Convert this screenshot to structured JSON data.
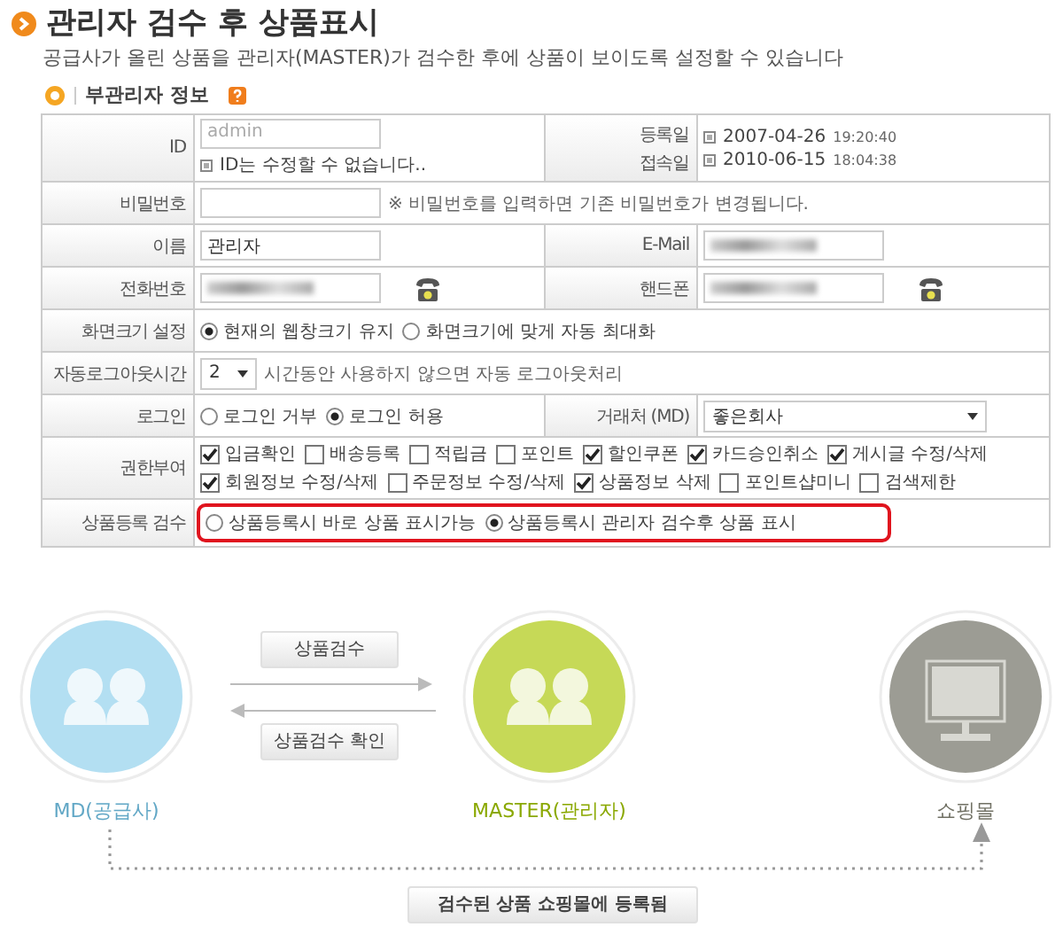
{
  "title": "관리자 검수 후 상품표시",
  "subtitle": "공급사가 올린 상품을 관리자(MASTER)가 검수한 후에 상품이 보이도록 설정할 수 있습니다",
  "section": {
    "title": "부관리자 정보"
  },
  "rows": [
    {
      "highlighted": false,
      "cells": [
        {
          "kind": "label",
          "labels": [
            "ID"
          ]
        },
        {
          "kind": "value",
          "lines": [
            [
              {
                "kind": "input",
                "value": "admin",
                "disabled": true
              }
            ],
            [
              {
                "kind": "note",
                "text": "ID는 수정할 수 없습니다.."
              }
            ]
          ]
        },
        {
          "kind": "label",
          "labels": [
            "등록일",
            "접속일"
          ]
        },
        {
          "kind": "value",
          "lines": [
            [
              {
                "kind": "date",
                "date": "2007-04-26",
                "time": "19:20:40"
              }
            ],
            [
              {
                "kind": "date",
                "date": "2010-06-15",
                "time": "18:04:38"
              }
            ]
          ]
        }
      ]
    },
    {
      "highlighted": false,
      "cells": [
        {
          "kind": "label",
          "labels": [
            "비밀번호"
          ]
        },
        {
          "kind": "value",
          "lines": [
            [
              {
                "kind": "input"
              },
              {
                "kind": "text",
                "text": "※ 비밀번호를 입력하면 기존 비밀번호가 변경됩니다."
              }
            ]
          ]
        }
      ]
    },
    {
      "highlighted": false,
      "cells": [
        {
          "kind": "label",
          "labels": [
            "이름"
          ]
        },
        {
          "kind": "value",
          "lines": [
            [
              {
                "kind": "input",
                "value": "관리자"
              }
            ]
          ]
        },
        {
          "kind": "label",
          "labels": [
            "E-Mail"
          ]
        },
        {
          "kind": "value",
          "lines": [
            [
              {
                "kind": "input",
                "blurred": true
              }
            ]
          ]
        }
      ]
    },
    {
      "highlighted": false,
      "cells": [
        {
          "kind": "label",
          "labels": [
            "전화번호"
          ]
        },
        {
          "kind": "value",
          "lines": [
            [
              {
                "kind": "input",
                "blurred": true
              },
              {
                "kind": "phone"
              }
            ]
          ]
        },
        {
          "kind": "label",
          "labels": [
            "핸드폰"
          ]
        },
        {
          "kind": "value",
          "lines": [
            [
              {
                "kind": "input",
                "blurred": true
              },
              {
                "kind": "phone"
              }
            ]
          ]
        }
      ]
    },
    {
      "highlighted": false,
      "cells": [
        {
          "kind": "label",
          "labels": [
            "화면크기 설정"
          ]
        },
        {
          "kind": "value",
          "lines": [
            [
              {
                "kind": "radio",
                "label": "현재의 웹창크기 유지",
                "selected": true
              },
              {
                "kind": "radio",
                "label": "화면크기에 맞게 자동 최대화",
                "selected": false
              }
            ]
          ]
        }
      ]
    },
    {
      "highlighted": false,
      "cells": [
        {
          "kind": "label",
          "labels": [
            "자동로그아웃시간"
          ]
        },
        {
          "kind": "value",
          "lines": [
            [
              {
                "kind": "select",
                "value": "2"
              },
              {
                "kind": "text",
                "text": "시간동안 사용하지 않으면 자동 로그아웃처리"
              }
            ]
          ]
        }
      ]
    },
    {
      "highlighted": false,
      "cells": [
        {
          "kind": "label",
          "labels": [
            "로그인"
          ]
        },
        {
          "kind": "value",
          "lines": [
            [
              {
                "kind": "radio",
                "label": "로그인 거부",
                "selected": false
              },
              {
                "kind": "radio",
                "label": "로그인 허용",
                "selected": true
              }
            ]
          ]
        },
        {
          "kind": "label",
          "labels": [
            "거래처 (MD)"
          ]
        },
        {
          "kind": "value",
          "lines": [
            [
              {
                "kind": "select",
                "value": "좋은회사"
              }
            ]
          ]
        }
      ]
    },
    {
      "highlighted": false,
      "cells": [
        {
          "kind": "label",
          "labels": [
            "권한부여"
          ]
        },
        {
          "kind": "value",
          "lines": [
            [
              {
                "kind": "checkbox",
                "label": "입금확인",
                "checked": true
              },
              {
                "kind": "checkbox",
                "label": "배송등록",
                "checked": false
              },
              {
                "kind": "checkbox",
                "label": "적립금",
                "checked": false
              },
              {
                "kind": "checkbox",
                "label": "포인트",
                "checked": false
              },
              {
                "kind": "checkbox",
                "label": "할인쿠폰",
                "checked": true
              },
              {
                "kind": "checkbox",
                "label": "카드승인취소",
                "checked": true
              },
              {
                "kind": "checkbox",
                "label": "게시글 수정/삭제",
                "checked": true
              }
            ],
            [
              {
                "kind": "checkbox",
                "label": "회원정보 수정/삭제",
                "checked": true
              },
              {
                "kind": "checkbox",
                "label": "주문정보 수정/삭제",
                "checked": false
              },
              {
                "kind": "checkbox",
                "label": "상품정보 삭제",
                "checked": true
              },
              {
                "kind": "checkbox",
                "label": "포인트샵미니",
                "checked": false
              },
              {
                "kind": "checkbox",
                "label": "검색제한",
                "checked": false
              }
            ]
          ]
        }
      ]
    },
    {
      "highlighted": true,
      "cells": [
        {
          "kind": "label",
          "labels": [
            "상품등록 검수"
          ]
        },
        {
          "kind": "value",
          "lines": [
            [
              {
                "kind": "radio",
                "label": "상품등록시 바로 상품 표시가능",
                "selected": false
              },
              {
                "kind": "radio",
                "label": "상품등록시 관리자 검수후 상품 표시",
                "selected": true
              }
            ]
          ]
        }
      ]
    }
  ],
  "diagram": {
    "nodes": [
      {
        "kind": "people",
        "label": "MD(공급사)",
        "color": "#b3dff2"
      },
      {
        "kind": "people",
        "label": "MASTER(관리자)",
        "color": "#c6d957"
      },
      {
        "kind": "monitor",
        "label": "쇼핑몰",
        "color": "#9c9c94"
      }
    ],
    "flows": [
      {
        "label": "상품검수"
      },
      {
        "label": "상품검수 확인"
      }
    ],
    "result": {
      "label": "검수된 상품 쇼핑몰에 등록됨"
    }
  }
}
